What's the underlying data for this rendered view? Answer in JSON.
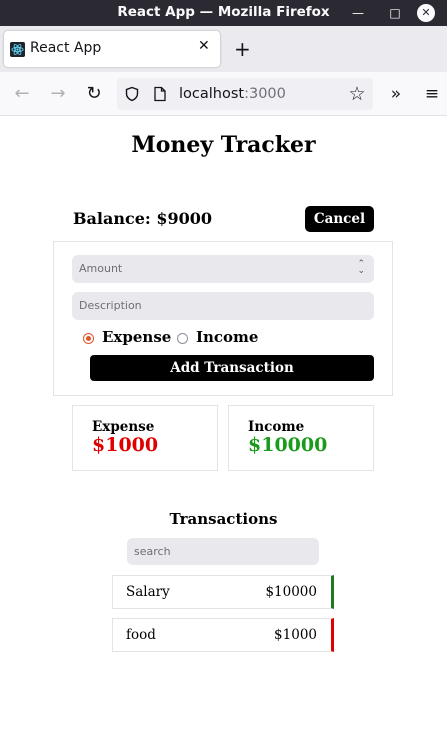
{
  "window": {
    "title": "React App — Mozilla Firefox"
  },
  "browser": {
    "tab_label": "React App",
    "url_host": "localhost",
    "url_port": ":3000"
  },
  "app": {
    "title": "Money Tracker",
    "balance": "Balance: $9000",
    "cancel_label": "Cancel",
    "form": {
      "amount_placeholder": "Amount",
      "description_placeholder": "Description",
      "type_options": [
        "Expense",
        "Income"
      ],
      "selected_type": "Expense",
      "submit_label": "Add Transaction"
    },
    "summary": {
      "expense_label": "Expense",
      "expense_value": "$1000",
      "income_label": "Income",
      "income_value": "$10000"
    },
    "transactions": {
      "heading": "Transactions",
      "search_placeholder": "search",
      "items": [
        {
          "name": "Salary",
          "amount": "$10000",
          "type": "income"
        },
        {
          "name": "food",
          "amount": "$1000",
          "type": "expense"
        }
      ]
    },
    "colors": {
      "expense": "#e00000",
      "income": "#1a9b1a",
      "income_bar": "#1f7a1f",
      "expense_bar": "#e00000"
    }
  },
  "icons": [
    "react-favicon-icon",
    "close-tab-icon",
    "new-tab-icon",
    "back-icon",
    "forward-icon",
    "reload-icon",
    "shield-icon",
    "page-icon",
    "bookmark-star-icon",
    "overflow-icon",
    "menu-icon"
  ]
}
